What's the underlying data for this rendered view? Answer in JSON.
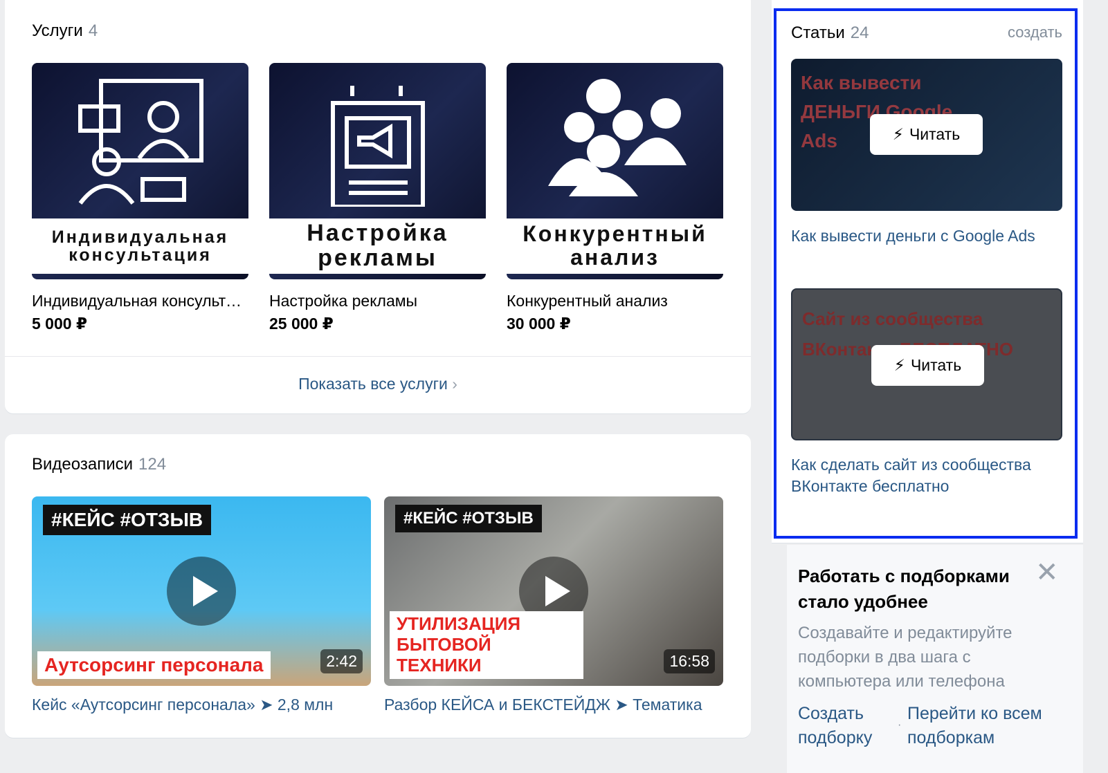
{
  "services": {
    "title": "Услуги",
    "count": "4",
    "items": [
      {
        "banner": "Индивидуальная консультация",
        "name": "Индивидуальная консультация",
        "price": "5 000 ₽"
      },
      {
        "banner": "Настройка рекламы",
        "name": "Настройка рекламы",
        "price": "25 000 ₽"
      },
      {
        "banner": "Конкурентный анализ",
        "name": "Конкурентный анализ",
        "price": "30 000 ₽"
      }
    ],
    "show_all": "Показать все услуги"
  },
  "videos": {
    "title": "Видеозаписи",
    "count": "124",
    "items": [
      {
        "tag": "#КЕЙС #ОТЗЫВ",
        "overlay": "Аутсорсинг персонала",
        "duration": "2:42",
        "caption": "Кейс «Аутсорсинг персонала» ➤ 2,8 млн"
      },
      {
        "tag": "#КЕЙС #ОТЗЫВ",
        "overlay": "УТИЛИЗАЦИЯ БЫТОВОЙ ТЕХНИКИ",
        "duration": "16:58",
        "caption": "Разбор КЕЙСА и БЕКСТЕЙДЖ ➤ Тематика"
      }
    ]
  },
  "articles": {
    "title": "Статьи",
    "count": "24",
    "create": "создать",
    "read_label": "Читать",
    "items": [
      {
        "cover": "Как вывести ДЕНЬГИ Google Ads",
        "title": "Как вывести деньги с Google Ads"
      },
      {
        "cover": "Сайт из сообщества ВКонтакте БЕСПЛАТНО",
        "title": "Как сделать сайт из сообщества ВКонтакте бесплатно"
      }
    ]
  },
  "promo": {
    "title": "Работать с подборками стало удобнее",
    "text": "Создавайте и редактируйте подборки в два шага с компьютера или телефона",
    "create": "Создать подборку",
    "all": "Перейти ко всем подборкам"
  },
  "colors": {
    "link": "#2a5885",
    "highlight": "#0a2cf0",
    "bg": "#edeef0"
  }
}
